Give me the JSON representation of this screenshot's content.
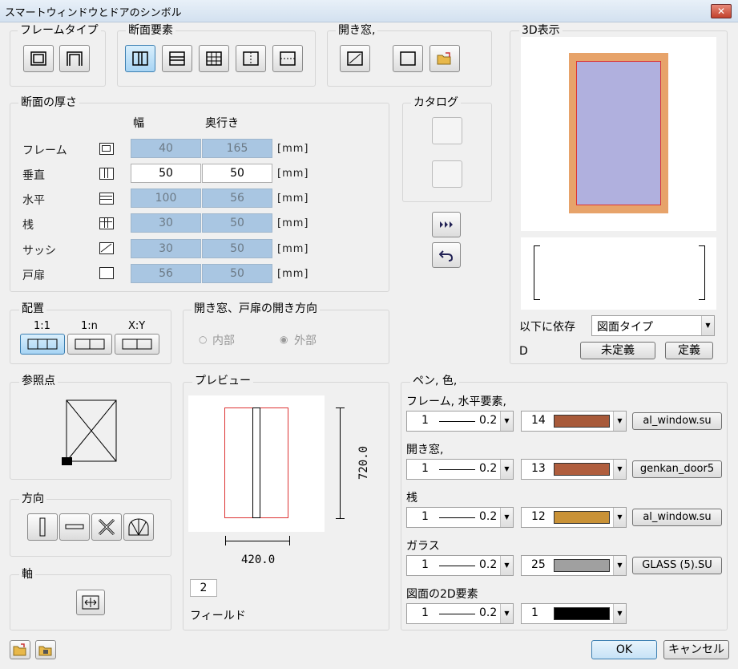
{
  "window": {
    "title": "スマートウィンドウとドアのシンボル",
    "close": "✕"
  },
  "frame_type": {
    "label": "フレームタイプ"
  },
  "section_elements": {
    "label": "断面要素"
  },
  "casement": {
    "label": "開き窓,"
  },
  "view3d": {
    "label": "3D表示"
  },
  "catalog": {
    "label": "カタログ"
  },
  "thickness": {
    "label": "断面の厚さ",
    "col_width": "幅",
    "col_depth": "奥行き",
    "rows": [
      {
        "name": "フレーム",
        "w": "40",
        "d": "165",
        "unit": "[mm]"
      },
      {
        "name": "垂直",
        "w": "50",
        "d": "50",
        "unit": "[mm]"
      },
      {
        "name": "水平",
        "w": "100",
        "d": "56",
        "unit": "[mm]"
      },
      {
        "name": "桟",
        "w": "30",
        "d": "50",
        "unit": "[mm]"
      },
      {
        "name": "サッシ",
        "w": "30",
        "d": "50",
        "unit": "[mm]"
      },
      {
        "name": "戸扉",
        "w": "56",
        "d": "50",
        "unit": "[mm]"
      }
    ]
  },
  "layout": {
    "label": "配置",
    "opt1": "1:1",
    "opt2": "1:n",
    "opt3": "X:Y"
  },
  "opening_dir": {
    "label": "開き窓、戸扉の開き方向",
    "inside": "内部",
    "outside": "外部"
  },
  "depends": {
    "label": "以下に依存",
    "value": "図面タイプ",
    "d_label": "D",
    "undefined_btn": "未定義",
    "define_btn": "定義"
  },
  "refpoint": {
    "label": "参照点"
  },
  "direction": {
    "label": "方向"
  },
  "axis": {
    "label": "軸"
  },
  "preview": {
    "label": "プレビュー",
    "height_dim": "720.0",
    "width_dim": "420.0",
    "field_value": "2",
    "field_label": "フィールド"
  },
  "pens": {
    "label": "ペン, 色,",
    "groups": [
      {
        "title": "フレーム, 水平要素,",
        "pen": "1",
        "weight": "0.2",
        "color_num": "14",
        "color": "#a85a3a",
        "material": "al_window.su"
      },
      {
        "title": "開き窓,",
        "pen": "1",
        "weight": "0.2",
        "color_num": "13",
        "color": "#b05e3e",
        "material": "genkan_door5"
      },
      {
        "title": "桟",
        "pen": "1",
        "weight": "0.2",
        "color_num": "12",
        "color": "#c99237",
        "material": "al_window.su"
      },
      {
        "title": "ガラス",
        "pen": "1",
        "weight": "0.2",
        "color_num": "25",
        "color": "#a0a0a0",
        "material": "GLASS (5).SU"
      },
      {
        "title": "図面の2D要素",
        "pen": "1",
        "weight": "0.2",
        "color_num": "1",
        "color": "#000000",
        "material": ""
      }
    ]
  },
  "footer": {
    "ok": "OK",
    "cancel": "キャンセル"
  }
}
